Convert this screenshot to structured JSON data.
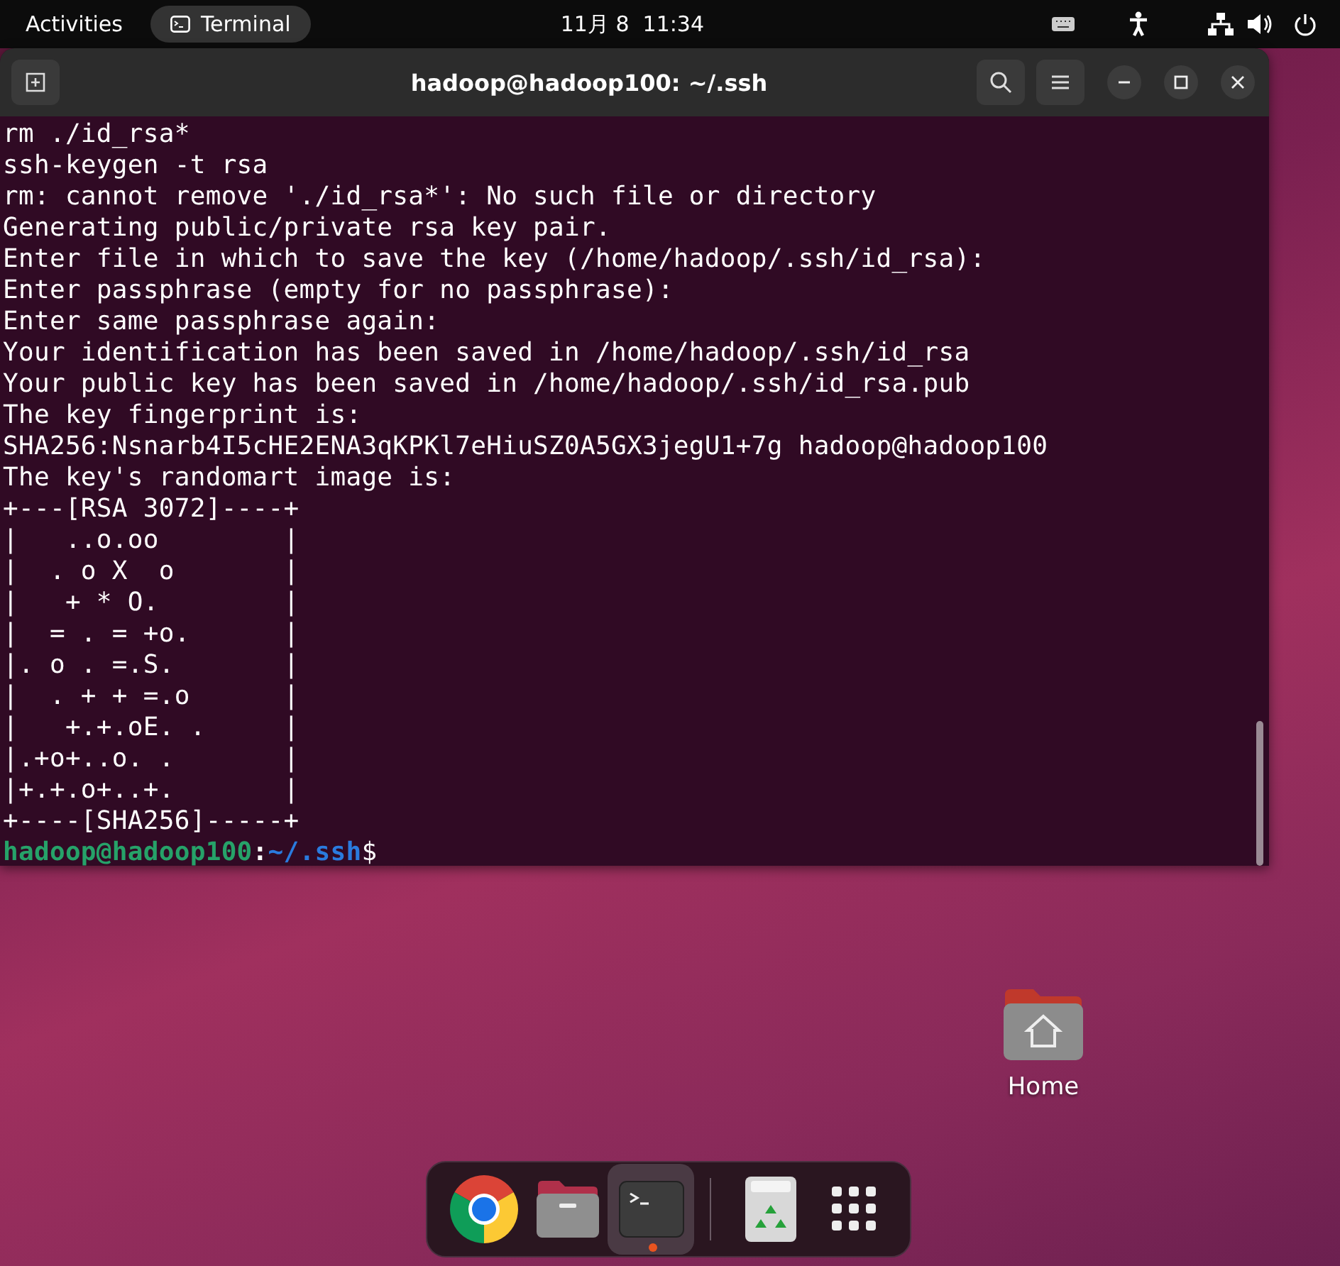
{
  "top_bar": {
    "activities": "Activities",
    "app": "Terminal",
    "clock": "11月 8  11:34"
  },
  "window": {
    "title": "hadoop@hadoop100: ~/.ssh",
    "lines": [
      "rm ./id_rsa*",
      "ssh-keygen -t rsa",
      "rm: cannot remove './id_rsa*': No such file or directory",
      "Generating public/private rsa key pair.",
      "Enter file in which to save the key (/home/hadoop/.ssh/id_rsa):",
      "Enter passphrase (empty for no passphrase):",
      "Enter same passphrase again:",
      "Your identification has been saved in /home/hadoop/.ssh/id_rsa",
      "Your public key has been saved in /home/hadoop/.ssh/id_rsa.pub",
      "The key fingerprint is:",
      "SHA256:Nsnarb4I5cHE2ENA3qKPKl7eHiuSZ0A5GX3jegU1+7g hadoop@hadoop100",
      "The key's randomart image is:",
      "+---[RSA 3072]----+",
      "|   ..o.oo        |",
      "|  . o X  o       |",
      "|   + * O.        |",
      "|  = . = +o.      |",
      "|. o . =.S.       |",
      "|  . + + =.o      |",
      "|   +.+.oE. .     |",
      "|.+o+..o. .       |",
      "|+.+.o+..+.       |",
      "+----[SHA256]-----+"
    ],
    "prompt": {
      "user": "hadoop@hadoop100",
      "separator": ":",
      "path": "~/.ssh",
      "symbol": "$"
    }
  },
  "desktop_icons": [
    {
      "label": "Home"
    }
  ],
  "dock": [
    {
      "kind": "browser",
      "running": false
    },
    {
      "kind": "files",
      "running": false
    },
    {
      "kind": "terminal",
      "running": true
    },
    {
      "kind": "separator"
    },
    {
      "kind": "trash",
      "running": false
    },
    {
      "kind": "apps"
    }
  ]
}
